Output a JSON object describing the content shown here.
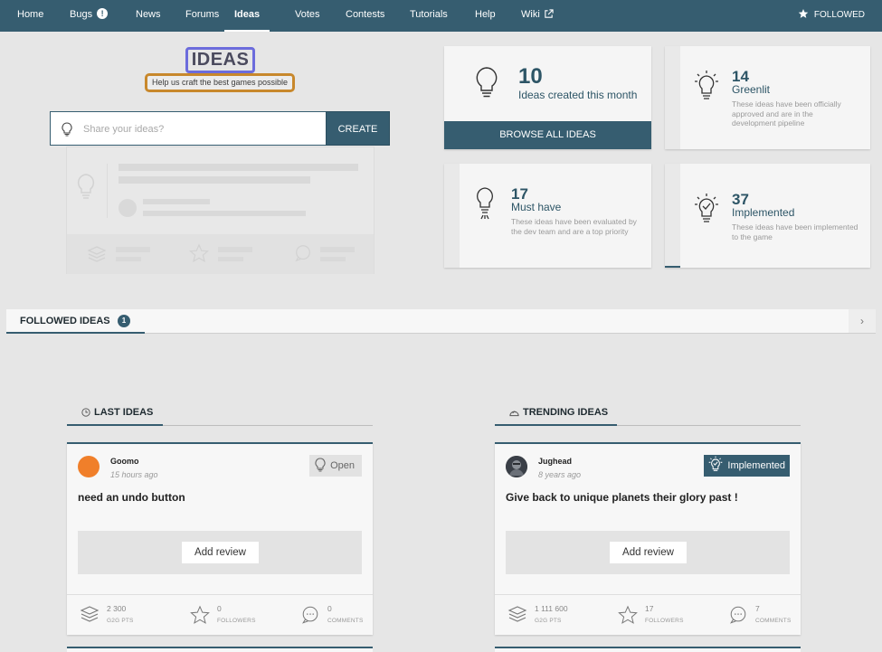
{
  "nav": {
    "items": [
      {
        "label": "Home",
        "active": false
      },
      {
        "label": "Bugs",
        "active": false,
        "badge": "!"
      },
      {
        "label": "News",
        "active": false
      },
      {
        "label": "Forums",
        "active": false
      },
      {
        "label": "Ideas",
        "active": true
      },
      {
        "label": "Votes",
        "active": false
      },
      {
        "label": "Contests",
        "active": false
      },
      {
        "label": "Tutorials",
        "active": false
      },
      {
        "label": "Help",
        "active": false
      },
      {
        "label": "Wiki",
        "active": false,
        "icon": "external-link-icon"
      }
    ],
    "followed_label": "FOLLOWED"
  },
  "hero": {
    "logo_text": "IDEAS",
    "tagline": "Help us craft the best games possible",
    "search_placeholder": "Share your ideas?",
    "create_label": "CREATE"
  },
  "stats": {
    "month": {
      "number": "10",
      "title": "Ideas created this month",
      "button": "BROWSE ALL IDEAS"
    },
    "greenlit": {
      "number": "14",
      "title": "Greenlit",
      "desc": "These ideas have been officially approved and are in the development pipeline"
    },
    "must_have": {
      "number": "17",
      "title": "Must have",
      "desc": "These ideas have been evaluated by the dev team and are a top priority"
    },
    "implemented": {
      "number": "37",
      "title": "Implemented",
      "desc": "These ideas have been implemented to the game"
    }
  },
  "followed": {
    "label": "FOLLOWED IDEAS",
    "count": "1"
  },
  "last_ideas": {
    "heading": "LAST IDEAS",
    "card": {
      "author": "Goomo",
      "time": "15 hours ago",
      "title": "need an undo button",
      "status": "Open",
      "review_label": "Add review",
      "pts_value": "2 300",
      "pts_label": "G2G PTS",
      "followers_value": "0",
      "followers_label": "FOLLOWERS",
      "comments_value": "0",
      "comments_label": "COMMENTS"
    }
  },
  "trending_ideas": {
    "heading": "TRENDING IDEAS",
    "card": {
      "author": "Jughead",
      "time": "8 years ago",
      "title": "Give back to unique planets their glory past !",
      "status": "Implemented",
      "review_label": "Add review",
      "pts_value": "1 111 600",
      "pts_label": "G2G PTS",
      "followers_value": "17",
      "followers_label": "FOLLOWERS",
      "comments_value": "7",
      "comments_label": "COMMENTS"
    }
  },
  "colors": {
    "primary": "#365d70",
    "background": "#e6e6e6",
    "logo_border": "#6c6cdc",
    "tagline_border": "#c8882c",
    "avatar_goomo": "#f07f2a"
  }
}
